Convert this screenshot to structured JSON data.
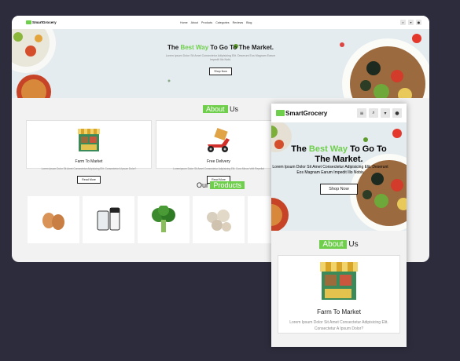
{
  "brand": {
    "name": "SmartGrocery",
    "accent": "#6fcf4c"
  },
  "nav": {
    "items": [
      "Home",
      "About",
      "Products",
      "Categories",
      "Reviews",
      "Blog"
    ]
  },
  "hero": {
    "title_pre": "The ",
    "title_highlight": "Best Way",
    "title_post": " To Go To The Market.",
    "text": "Lorem Ipsum Dolor Sit Amet Consectetur Adipisicing Elit. Deserunt Eos Magnam Earum Impedit Illo Nobi.",
    "button": "Shop Now"
  },
  "about": {
    "tag": "About",
    "rest": " Us"
  },
  "features": [
    {
      "title": "Farm To Market",
      "text": "Lorem Ipsum Dolor Sit Amet Consectetur Adipisicing Elit. Consectetur A Ipsum Dolor?",
      "button": "Read More"
    },
    {
      "title": "Free Delivery",
      "text": "Loremipsum Dolor Sit Amet Consectetur Adipisicing Elit. Cura Minus Velit Repellat",
      "button": "Read More"
    }
  ],
  "products": {
    "pre": "Our ",
    "tag": "Products"
  },
  "phone": {
    "hero_text": "Lorem Ipsum Dolor Sit Amet Consectetur Adipisicing Elit. Deserunt Eos Magnam Earum Impedit Illo Nobis",
    "card_text": "Lorem Ipsum Dolor Sit Amet Consectetur Adipisicing Elit. Consectetur A Ipsum Dolor?"
  }
}
